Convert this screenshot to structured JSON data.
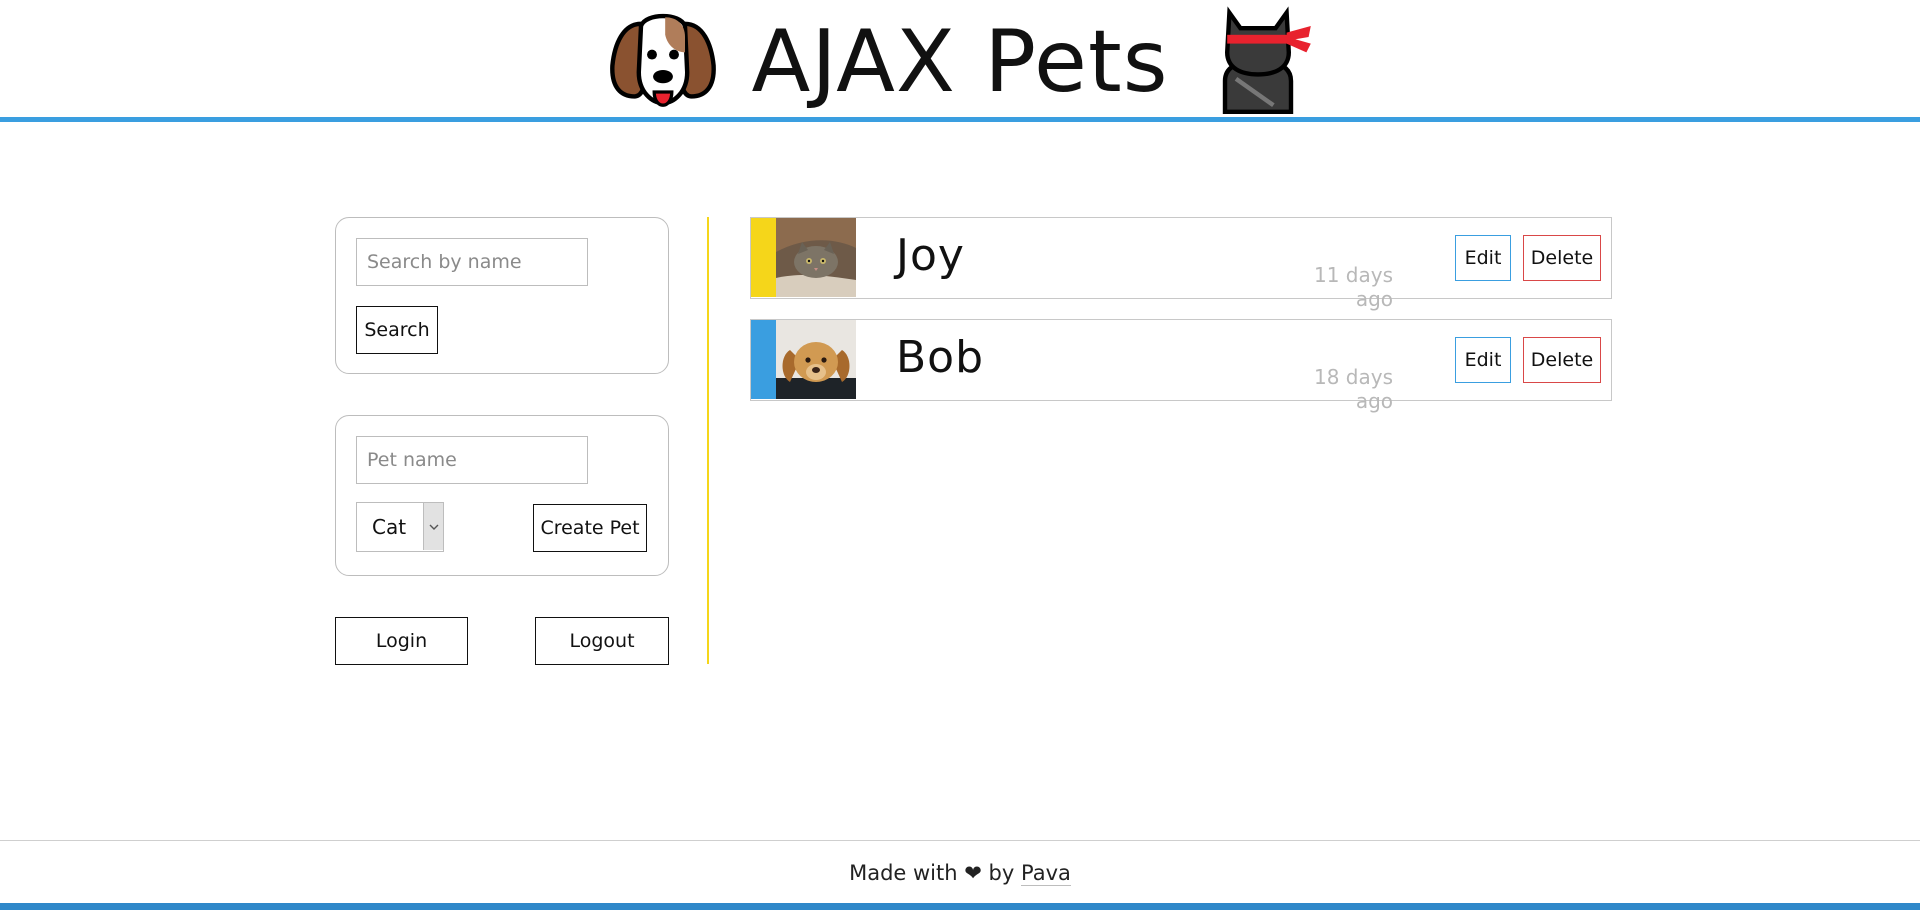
{
  "header": {
    "title": "AJAX Pets",
    "left_icon": "dog-face-icon",
    "right_icon": "ninja-cat-icon",
    "accent_color": "#3a9ee0"
  },
  "search": {
    "placeholder": "Search by name",
    "button_label": "Search"
  },
  "create": {
    "placeholder": "Pet name",
    "type_selected": "Cat",
    "button_label": "Create Pet"
  },
  "auth": {
    "login_label": "Login",
    "logout_label": "Logout"
  },
  "pets": [
    {
      "name": "Joy",
      "time": "11 days ago",
      "stripe_color": "#f5d61a",
      "photo": "cat-photo"
    },
    {
      "name": "Bob",
      "time": "18 days ago",
      "stripe_color": "#3a9ee0",
      "photo": "dog-photo"
    }
  ],
  "pet_actions": {
    "edit_label": "Edit",
    "delete_label": "Delete"
  },
  "footer": {
    "made_with": "Made with",
    "heart_icon": "heart-icon",
    "by": "by",
    "author": "Pava"
  },
  "divider_color": "#f5d61a"
}
